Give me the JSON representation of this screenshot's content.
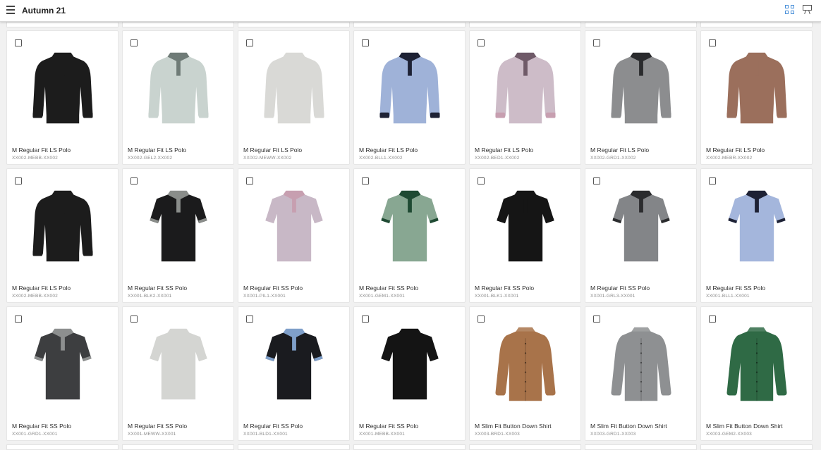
{
  "header": {
    "title": "Autumn 21"
  },
  "icons": {
    "menu": "hamburger-icon",
    "grid_view": "grid-view-icon",
    "present": "presentation-icon",
    "accent": "#4a90d9"
  },
  "products": [
    {
      "name": "M Regular Fit LS Polo",
      "code": "XX002-MEBB-XX002",
      "style": "ls",
      "body": "#1c1c1c",
      "collar": "#1c1c1c",
      "trim": "#1c1c1c"
    },
    {
      "name": "M Regular Fit LS Polo",
      "code": "XX002-GEL2-XX002",
      "style": "ls",
      "body": "#c9d3cf",
      "collar": "#6f7b77",
      "trim": "#c9d3cf"
    },
    {
      "name": "M Regular Fit LS Polo",
      "code": "XX002-MEWW-XX002",
      "style": "ls",
      "body": "#d9d9d6",
      "collar": "#d9d9d6",
      "trim": "#d9d9d6"
    },
    {
      "name": "M Regular Fit LS Polo",
      "code": "XX002-BLL1-XX002",
      "style": "ls",
      "body": "#9fb2d8",
      "collar": "#1e2235",
      "trim": "#1e2235"
    },
    {
      "name": "M Regular Fit LS Polo",
      "code": "XX002-BED1-XX002",
      "style": "ls",
      "body": "#cdbcc8",
      "collar": "#6f5a68",
      "trim": "#c79fb0"
    },
    {
      "name": "M Regular Fit LS Polo",
      "code": "XX002-GRD1-XX002",
      "style": "ls",
      "body": "#8c8d8f",
      "collar": "#2a2b2d",
      "trim": "#8c8d8f"
    },
    {
      "name": "M Regular Fit LS Polo",
      "code": "XX002-MEBR-XX002",
      "style": "ls",
      "body": "#9b6f5c",
      "collar": "#9b6f5c",
      "trim": "#9b6f5c"
    },
    {
      "name": "M Regular Fit LS Polo",
      "code": "XX002-MEBB-XX002",
      "style": "ls",
      "body": "#1c1c1c",
      "collar": "#1c1c1c",
      "trim": "#1c1c1c"
    },
    {
      "name": "M Regular Fit SS Polo",
      "code": "XX001-BLK2-XX001",
      "style": "ss",
      "body": "#1b1b1c",
      "collar": "#8a8d8a",
      "trim": "#8a8d8a"
    },
    {
      "name": "M Regular Fit SS Polo",
      "code": "XX001-PIL1-XX001",
      "style": "ss",
      "body": "#c8b8c6",
      "collar": "#c79fb0",
      "trim": "#c8b8c6"
    },
    {
      "name": "M Regular Fit SS Polo",
      "code": "XX001-GEM1-XX001",
      "style": "ss",
      "body": "#88a792",
      "collar": "#1f4a33",
      "trim": "#1f4a33"
    },
    {
      "name": "M Regular Fit SS Polo",
      "code": "XX001-BLK1-XX001",
      "style": "ss",
      "body": "#151515",
      "collar": "#151515",
      "trim": "#151515"
    },
    {
      "name": "M Regular Fit SS Polo",
      "code": "XX001-GRL3-XX001",
      "style": "ss",
      "body": "#838588",
      "collar": "#2b2c2e",
      "trim": "#2b2c2e"
    },
    {
      "name": "M Regular Fit SS Polo",
      "code": "XX001-BLL1-XX001",
      "style": "ss",
      "body": "#a4b6dc",
      "collar": "#1e2235",
      "trim": "#1e2235"
    },
    {
      "name": "M Regular Fit SS Polo",
      "code": "XX001-GRD1-XX001",
      "style": "ss",
      "body": "#3d3e40",
      "collar": "#8d8f8f",
      "trim": "#8d8f8f"
    },
    {
      "name": "M Regular Fit SS Polo",
      "code": "XX001-MEWW-XX001",
      "style": "ss",
      "body": "#d4d5d2",
      "collar": "#d4d5d2",
      "trim": "#d4d5d2"
    },
    {
      "name": "M Regular Fit SS Polo",
      "code": "XX001-BLD1-XX001",
      "style": "ss",
      "body": "#1a1b1f",
      "collar": "#7f9fc9",
      "trim": "#7f9fc9"
    },
    {
      "name": "M Regular Fit SS Polo",
      "code": "XX001-MEBB-XX001",
      "style": "ss",
      "body": "#141414",
      "collar": "#141414",
      "trim": "#141414"
    },
    {
      "name": "M Slim Fit Button Down Shirt",
      "code": "XX003-BRD1-XX003",
      "style": "shirt",
      "body": "#a8734a",
      "collar": "#a8734a",
      "trim": "#a8734a"
    },
    {
      "name": "M Slim Fit Button Down Shirt",
      "code": "XX003-GRD1-XX003",
      "style": "shirt",
      "body": "#8e9092",
      "collar": "#8e9092",
      "trim": "#8e9092"
    },
    {
      "name": "M Slim Fit Button Down Shirt",
      "code": "XX003-GEM2-XX003",
      "style": "shirt",
      "body": "#2f6a45",
      "collar": "#2f6a45",
      "trim": "#2f6a45"
    }
  ]
}
